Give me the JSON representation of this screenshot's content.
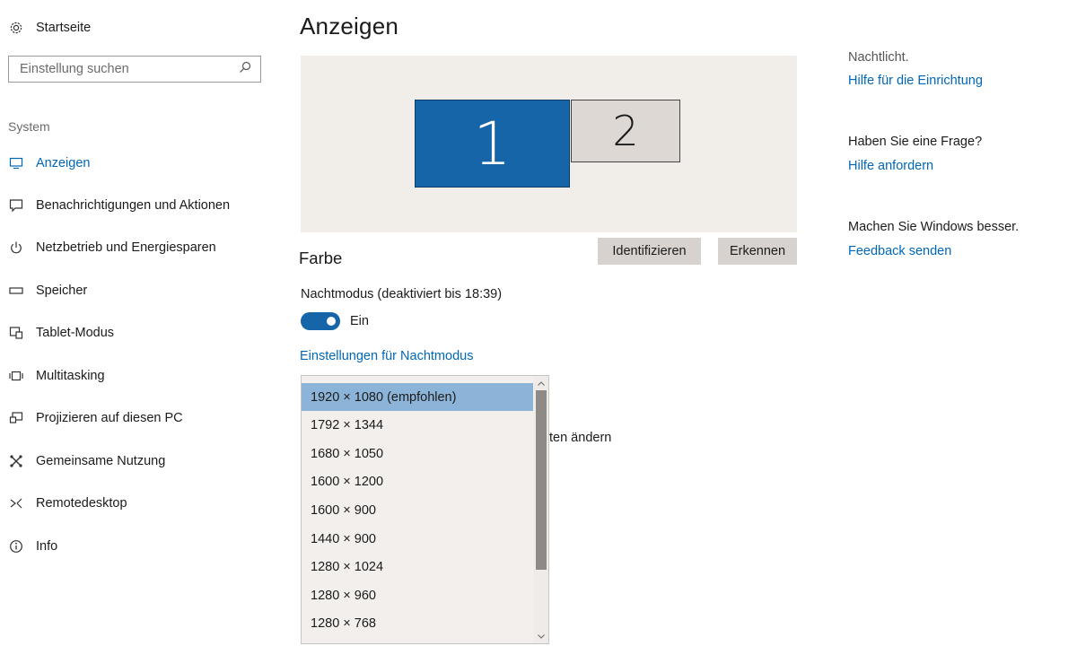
{
  "sidebar": {
    "home_label": "Startseite",
    "search_placeholder": "Einstellung suchen",
    "section": "System",
    "items": [
      {
        "label": "Anzeigen",
        "icon": "monitor-icon"
      },
      {
        "label": "Benachrichtigungen und Aktionen",
        "icon": "notification-icon"
      },
      {
        "label": "Netzbetrieb und Energiesparen",
        "icon": "power-icon"
      },
      {
        "label": "Speicher",
        "icon": "storage-icon"
      },
      {
        "label": "Tablet-Modus",
        "icon": "tablet-mode-icon"
      },
      {
        "label": "Multitasking",
        "icon": "multitasking-icon"
      },
      {
        "label": "Projizieren auf diesen PC",
        "icon": "project-icon"
      },
      {
        "label": "Gemeinsame Nutzung",
        "icon": "share-icon"
      },
      {
        "label": "Remotedesktop",
        "icon": "remote-desktop-icon"
      },
      {
        "label": "Info",
        "icon": "info-icon"
      }
    ]
  },
  "main": {
    "title": "Anzeigen",
    "monitors": [
      {
        "label": "1"
      },
      {
        "label": "2"
      }
    ],
    "identify_button": "Identifizieren",
    "detect_button": "Erkennen",
    "color_heading": "Farbe",
    "night_mode_label": "Nachtmodus (deaktiviert bis 18:39)",
    "night_mode_toggle_label": "Ein",
    "night_mode_on": true,
    "night_mode_settings_link": "Einstellungen für Nachtmodus",
    "partial_text": "ten ändern",
    "resolution_options": [
      "1920 × 1080 (empfohlen)",
      "1792 × 1344",
      "1680 × 1050",
      "1600 × 1200",
      "1600 × 900",
      "1440 × 900",
      "1280 × 1024",
      "1280 × 960",
      "1280 × 768"
    ],
    "selected_resolution": "1920 × 1080 (empfohlen)"
  },
  "right": {
    "night_light_text": "Nachtlicht.",
    "setup_help_link": "Hilfe für die Einrichtung",
    "question_text": "Haben Sie eine Frage?",
    "get_help_link": "Hilfe anfordern",
    "improve_text": "Machen Sie Windows besser.",
    "feedback_link": "Feedback senden"
  },
  "colors": {
    "accent": "#0067b8",
    "monitor_active": "#1565a8",
    "selection": "#8cb4d8"
  }
}
